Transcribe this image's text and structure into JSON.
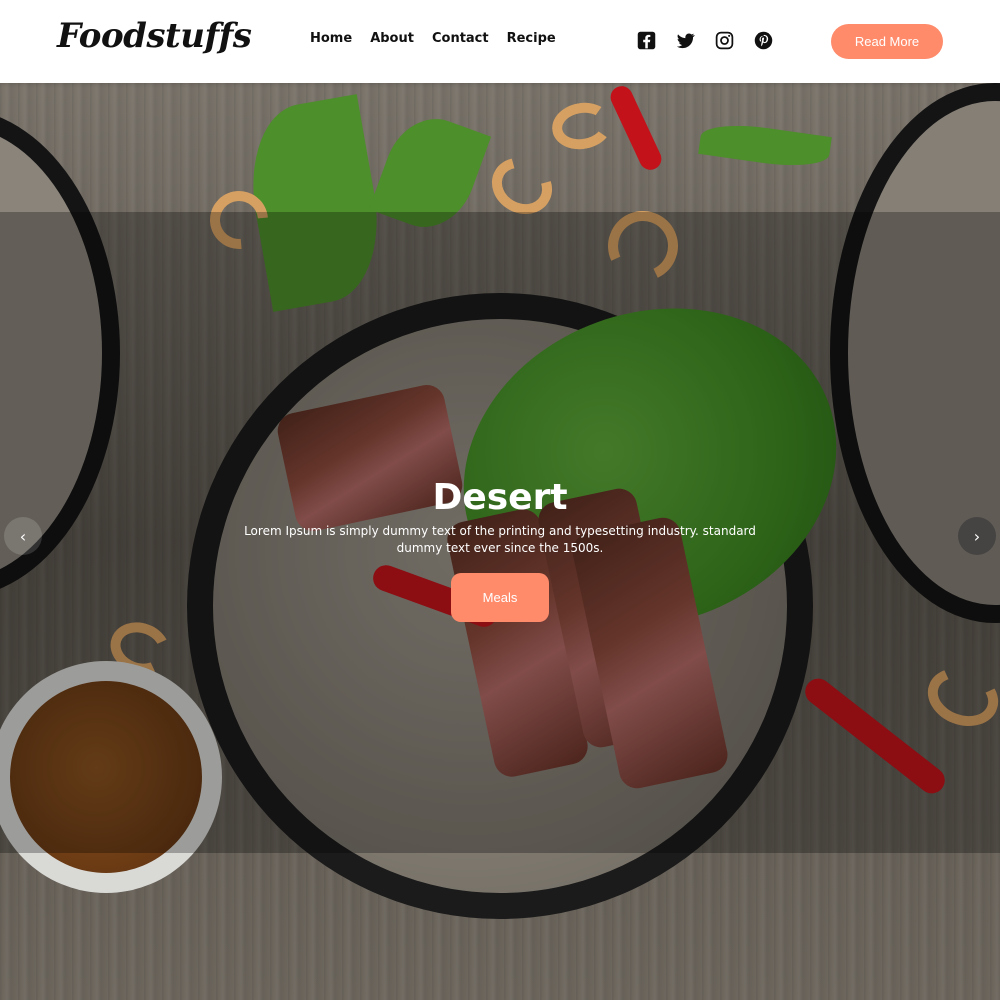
{
  "brand": {
    "logo": "Foodstuffs"
  },
  "nav": {
    "items": [
      "Home",
      "About",
      "Contact",
      "Recipe"
    ]
  },
  "social": {
    "icons": [
      "facebook-icon",
      "twitter-icon",
      "instagram-icon",
      "pinterest-icon"
    ]
  },
  "header": {
    "cta_label": "Read More"
  },
  "hero": {
    "title": "Desert",
    "text": "Lorem Ipsum is simply dummy text of the printing and typesetting industry. standard dummy text ever since the 1500s.",
    "button_label": "Meals",
    "prev_arrow": "‹",
    "next_arrow": "›"
  },
  "colors": {
    "accent": "#ff8b6b",
    "text_dark": "#111111",
    "overlay": "rgba(0,0,0,0.28)"
  }
}
